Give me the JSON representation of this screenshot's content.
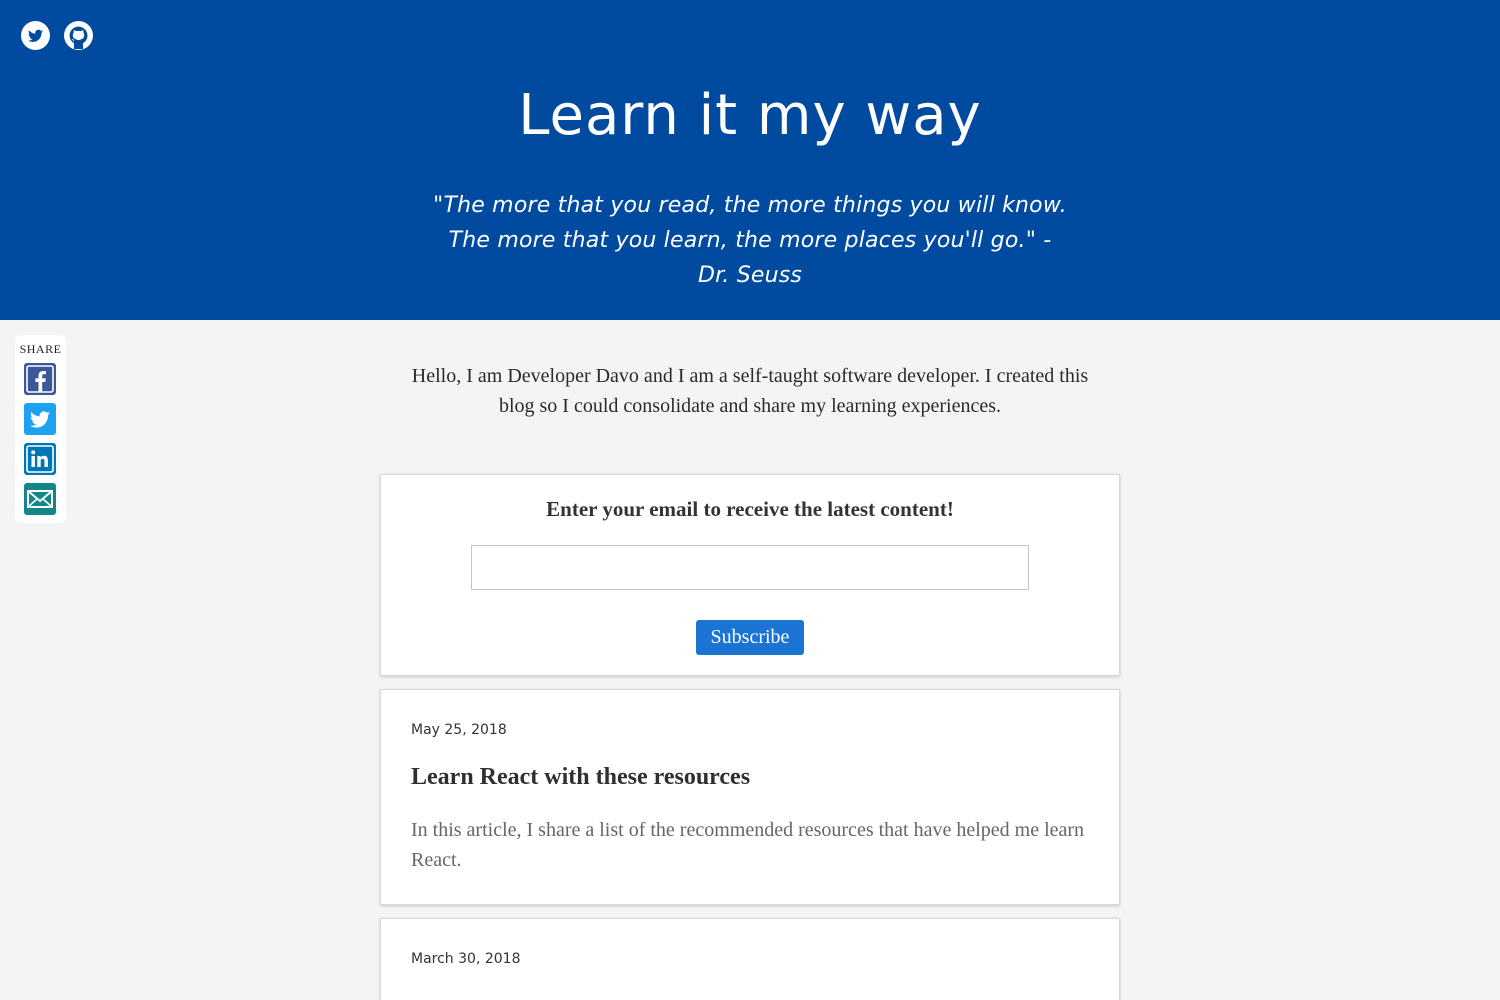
{
  "header": {
    "title": "Learn it my way",
    "quote": "\"The more that you read, the more things you will know. The more that you learn, the more places you'll go.\" - Dr. Seuss",
    "social": [
      {
        "name": "twitter-icon"
      },
      {
        "name": "github-icon"
      }
    ],
    "colors": {
      "background": "#004ba0",
      "text": "#ffffff"
    }
  },
  "share": {
    "label": "SHARE",
    "buttons": [
      {
        "name": "facebook-share",
        "color": "#3b5998"
      },
      {
        "name": "twitter-share",
        "color": "#1da1f2"
      },
      {
        "name": "linkedin-share",
        "color": "#0077b5"
      },
      {
        "name": "email-share",
        "color": "#11878a"
      }
    ]
  },
  "intro": {
    "text": "Hello, I am Developer Davo and I am a self-taught software developer. I created this blog so I could consolidate and share my learning experiences."
  },
  "subscribe": {
    "heading": "Enter your email to receive the latest content!",
    "email_value": "",
    "button_label": "Subscribe",
    "button_color": "#1b74d4"
  },
  "posts": [
    {
      "date": "May 25, 2018",
      "title": "Learn React with these resources",
      "excerpt": "In this article, I share a list of the recommended resources that have helped me learn React."
    },
    {
      "date": "March 30, 2018",
      "title": ""
    }
  ]
}
